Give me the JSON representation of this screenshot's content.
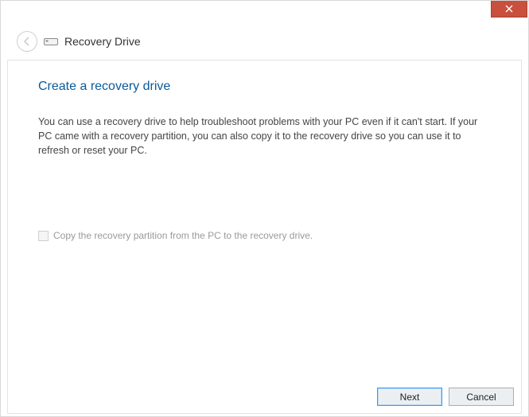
{
  "window": {
    "title": "Recovery Drive"
  },
  "page": {
    "heading": "Create a recovery drive",
    "body": "You can use a recovery drive to help troubleshoot problems with your PC even if it can't start. If your PC came with a recovery partition, you can also copy it to the recovery drive so you can use it to refresh or reset your PC."
  },
  "checkbox": {
    "label": "Copy the recovery partition from the PC to the recovery drive.",
    "enabled": false,
    "checked": false
  },
  "buttons": {
    "next": "Next",
    "cancel": "Cancel"
  }
}
